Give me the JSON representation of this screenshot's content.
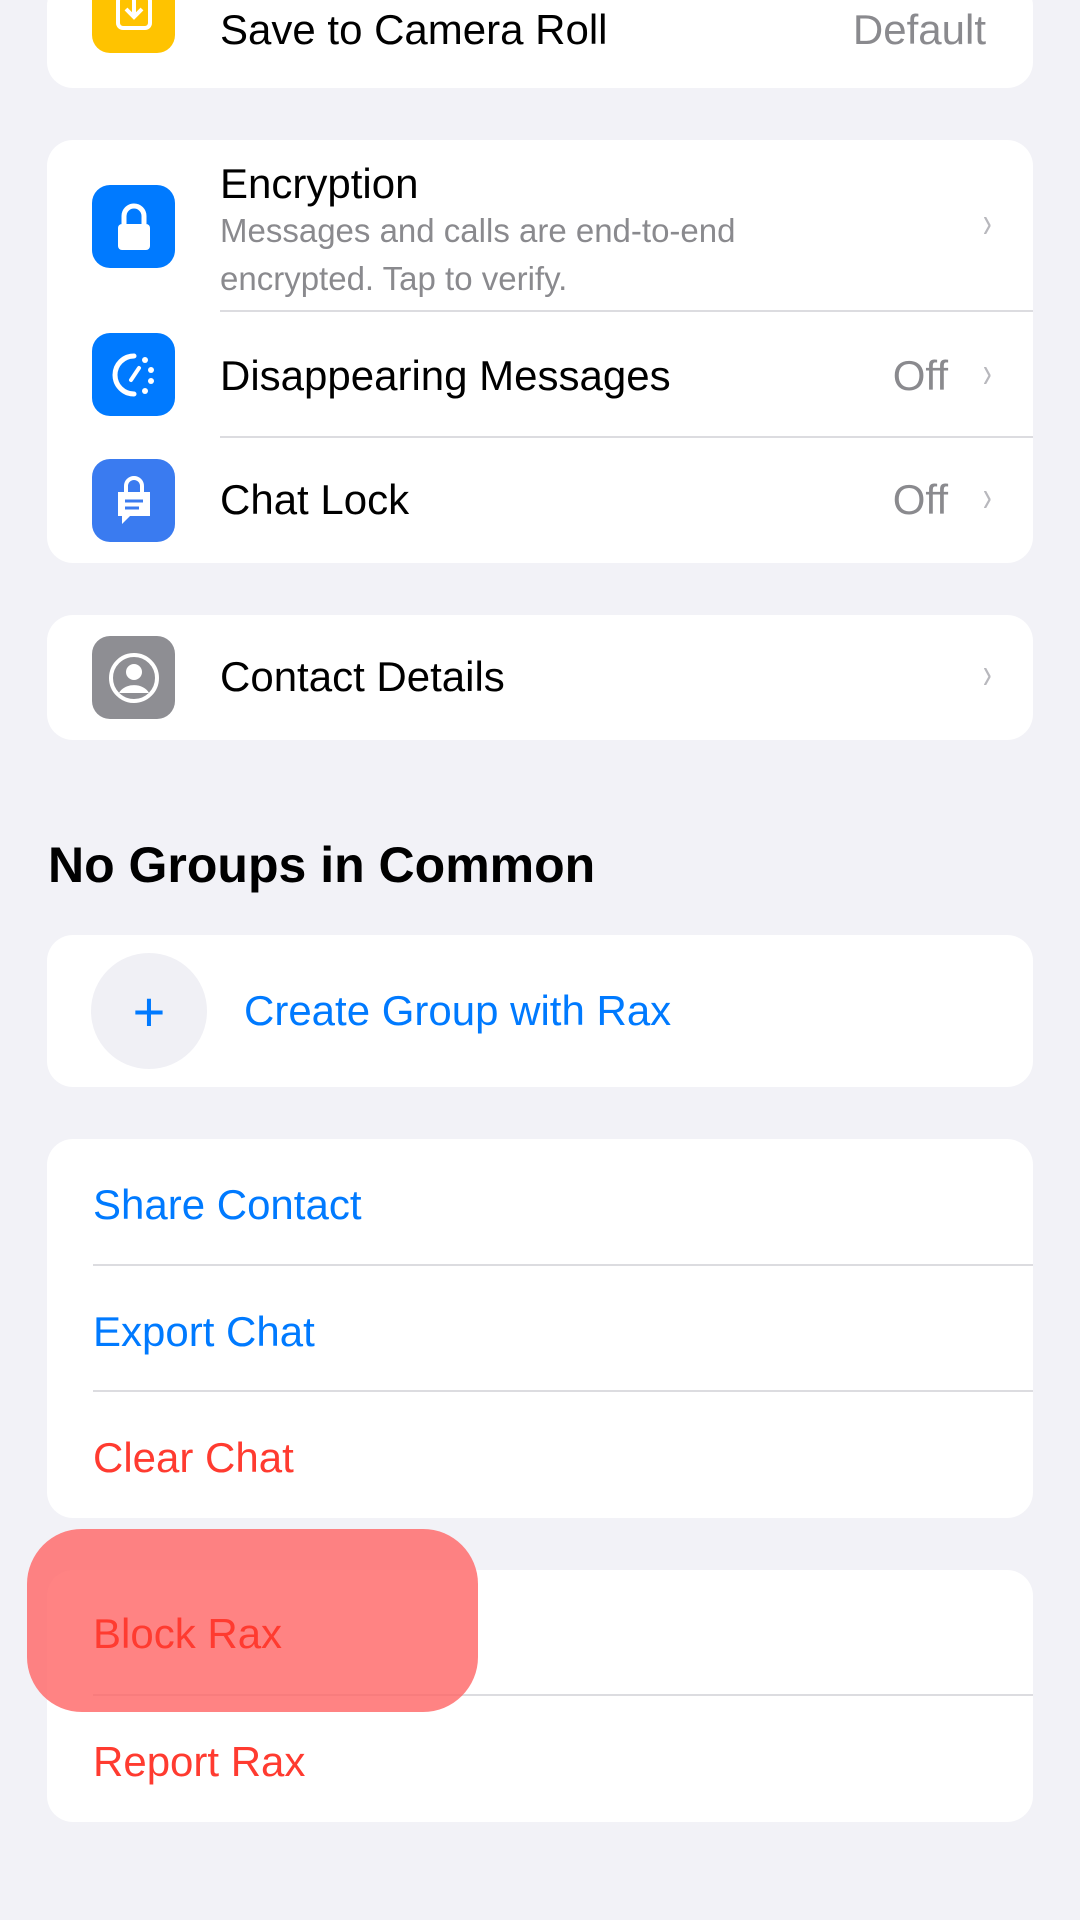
{
  "colors": {
    "background": "#f2f2f7",
    "blue": "#007aff",
    "red": "#ff3b30",
    "highlight": "#ff7f7f"
  },
  "media": {
    "save_label": "Save to Camera Roll",
    "save_value": "Default",
    "icon": "save-download-icon"
  },
  "privacy": {
    "encryption": {
      "label": "Encryption",
      "subtitle_line1": "Messages and calls are end-to-end",
      "subtitle_line2": "encrypted. Tap to verify.",
      "icon": "lock-icon"
    },
    "disappearing": {
      "label": "Disappearing Messages",
      "value": "Off",
      "icon": "timer-icon"
    },
    "chat_lock": {
      "label": "Chat Lock",
      "value": "Off",
      "icon": "chat-lock-icon"
    }
  },
  "contact": {
    "label": "Contact Details",
    "icon": "person-icon"
  },
  "groups": {
    "header": "No Groups in Common",
    "create_label": "Create Group with Rax",
    "plus": "+"
  },
  "actions": {
    "share": "Share Contact",
    "export": "Export Chat",
    "clear": "Clear Chat"
  },
  "danger": {
    "block": "Block Rax",
    "report": "Report Rax"
  },
  "chevron": "›"
}
